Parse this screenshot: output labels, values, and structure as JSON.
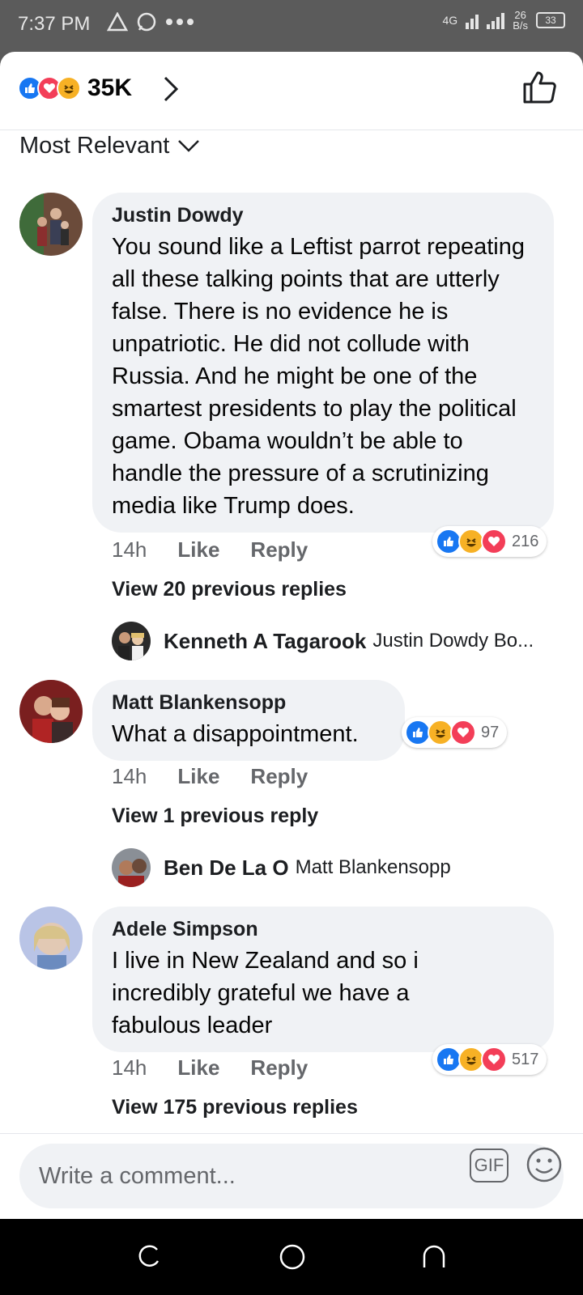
{
  "status_bar": {
    "time": "7:37 PM",
    "network": "4G",
    "speed_value": "26",
    "speed_unit": "B/s",
    "battery": "33"
  },
  "reactions_header": {
    "count": "35K",
    "icons": [
      "like-icon",
      "love-icon",
      "haha-icon"
    ]
  },
  "sort": {
    "label": "Most Relevant"
  },
  "comments": [
    {
      "author": "Justin Dowdy",
      "text": "You sound like a Leftist parrot repeating all these talking points that are utterly false. There is no evidence he is unpatriotic. He did not collude with Russia. And he might be one of the smartest presidents to play the political game.  Obama wouldn’t be able to handle the pressure of a scrutinizing media like Trump does.",
      "time": "14h",
      "like_label": "Like",
      "reply_label": "Reply",
      "reaction_count": "216",
      "view_replies": "View 20 previous replies",
      "reply_preview": {
        "name": "Kenneth A Tagarook",
        "snippet": "Justin Dowdy Bo..."
      }
    },
    {
      "author": "Matt Blankensopp",
      "text": "What a disappointment.",
      "time": "14h",
      "like_label": "Like",
      "reply_label": "Reply",
      "reaction_count": "97",
      "view_replies": "View 1 previous reply",
      "reply_preview": {
        "name": "Ben De La O",
        "snippet": "Matt Blankensopp"
      }
    },
    {
      "author": "Adele Simpson",
      "text": "I live in New Zealand and so i incredibly grateful we have a fabulous leader",
      "time": "14h",
      "like_label": "Like",
      "reply_label": "Reply",
      "reaction_count": "517",
      "view_replies": "View 175 previous replies"
    }
  ],
  "composer": {
    "placeholder": "Write a comment...",
    "gif_label": "GIF"
  },
  "colors": {
    "like_blue": "#1877f2",
    "love_red": "#f33e58",
    "haha_yellow": "#f7b125",
    "bubble_gray": "#f0f2f5",
    "meta_gray": "#65676b"
  }
}
